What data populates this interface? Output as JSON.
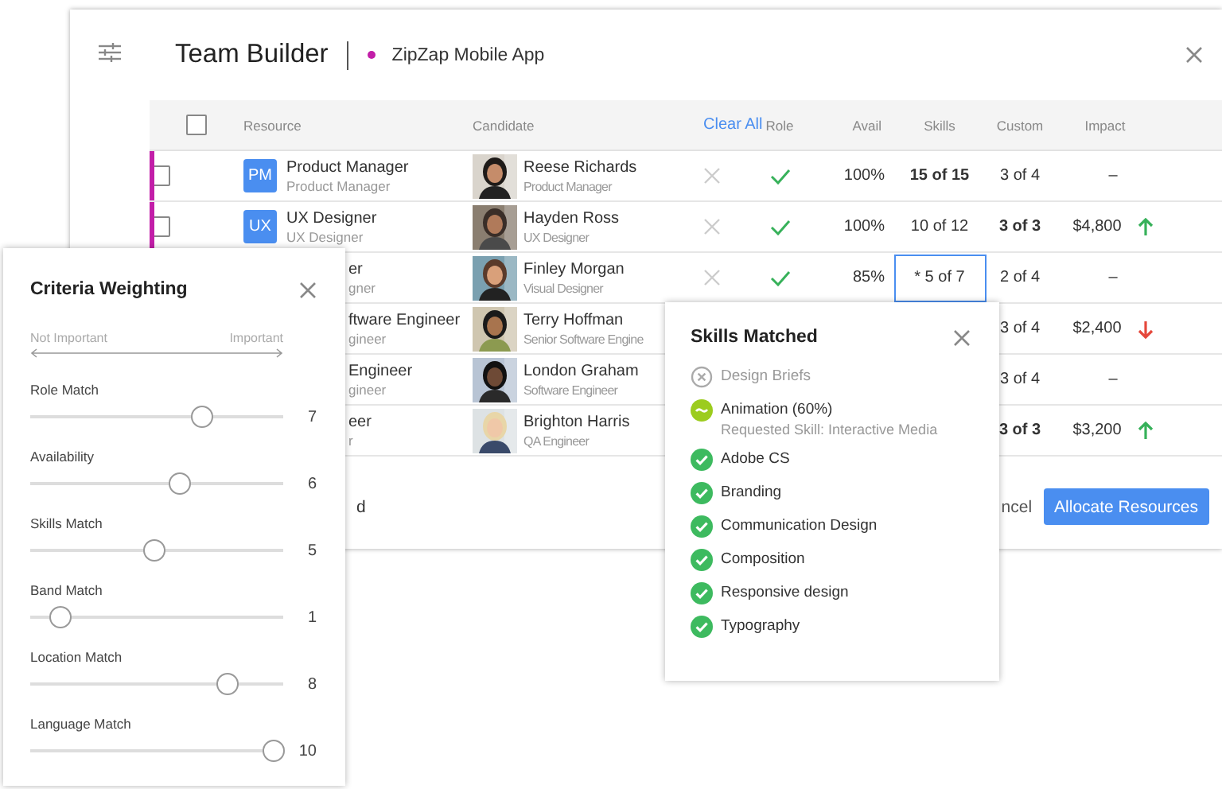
{
  "window": {
    "title": "Team Builder",
    "project": "ZipZap Mobile App"
  },
  "table": {
    "select_all": {
      "checked": false
    },
    "columns": [
      {
        "label": "Resource",
        "kind": "text"
      },
      {
        "label": "Candidate",
        "kind": "text"
      },
      {
        "label": "Clear All",
        "kind": "link"
      },
      {
        "label": "Role",
        "kind": "text"
      },
      {
        "label": "Avail",
        "kind": "text"
      },
      {
        "label": "Skills",
        "kind": "text"
      },
      {
        "label": "Custom",
        "kind": "text"
      },
      {
        "label": "Impact",
        "kind": "text"
      }
    ],
    "rows": [
      {
        "flagged": true,
        "checked": false,
        "badge": "PM",
        "resource": "Product Manager",
        "resource_sub": "Product Manager",
        "candidate": "Reese Richards",
        "candidate_role": "Product Manager",
        "removable": true,
        "role_match": true,
        "avail": "100%",
        "skills": {
          "text": "15 of 15",
          "complete": true,
          "selected": false
        },
        "custom": {
          "text": "3 of 4",
          "complete": false
        },
        "impact": {
          "text": "–"
        }
      },
      {
        "flagged": true,
        "checked": false,
        "badge": "UX",
        "resource": "UX Designer",
        "resource_sub": "UX Designer",
        "candidate": "Hayden Ross",
        "candidate_role": "UX Designer",
        "removable": true,
        "role_match": true,
        "avail": "100%",
        "skills": {
          "text": "10 of 12",
          "complete": false,
          "selected": false
        },
        "custom": {
          "text": "3 of 3",
          "complete": true
        },
        "impact": {
          "text": "$4,800",
          "rising": true
        }
      },
      {
        "resource": "er",
        "resource_sub": "gner",
        "candidate": "Finley Morgan",
        "candidate_role": "Visual Designer",
        "removable": true,
        "role_match": true,
        "avail": "85%",
        "skills": {
          "text": "* 5 of 7",
          "complete": false,
          "selected": true
        },
        "custom": {
          "text": "2 of 4",
          "complete": false
        },
        "impact": {
          "text": "–"
        }
      },
      {
        "resource": "ftware Engineer",
        "resource_sub": "gineer",
        "candidate": "Terry Hoffman",
        "candidate_role": "Senior Software Engine",
        "custom": {
          "text": "3 of 4",
          "complete": false
        },
        "impact": {
          "text": "$2,400",
          "rising": false
        }
      },
      {
        "resource": "Engineer",
        "resource_sub": "gineer",
        "candidate": "London Graham",
        "candidate_role": "Software Engineer",
        "custom": {
          "text": "3 of 4",
          "complete": false
        },
        "impact": {
          "text": "–"
        }
      },
      {
        "resource": "eer",
        "resource_sub": "r",
        "candidate": "Brighton Harris",
        "candidate_role": "QA Engineer",
        "custom": {
          "text": "3 of 3",
          "complete": true
        },
        "impact": {
          "text": "$3,200",
          "rising": true
        }
      }
    ]
  },
  "footer": {
    "left_fragment": "d",
    "cancel": "ncel",
    "primary": "Allocate Resources"
  },
  "criteria": {
    "title": "Criteria Weighting",
    "scale_low": "Not Important",
    "scale_high": "Important",
    "sliders": [
      {
        "label": "Role Match",
        "level": 0.68,
        "reading": "7"
      },
      {
        "label": "Availability",
        "level": 0.59,
        "reading": "6"
      },
      {
        "label": "Skills Match",
        "level": 0.49,
        "reading": "5"
      },
      {
        "label": "Band Match",
        "level": 0.12,
        "reading": "1"
      },
      {
        "label": "Location Match",
        "level": 0.78,
        "reading": "8"
      },
      {
        "label": "Language Match",
        "level": 0.96,
        "reading": "10"
      }
    ]
  },
  "skills_popup": {
    "title": "Skills Matched",
    "items": [
      {
        "kind": "missing",
        "label": "Design Briefs"
      },
      {
        "kind": "partial",
        "label": "Animation (60%)",
        "note": "Requested Skill: Interactive Media"
      },
      {
        "kind": "matched",
        "label": "Adobe CS"
      },
      {
        "kind": "matched",
        "label": "Branding"
      },
      {
        "kind": "matched",
        "label": "Communication Design"
      },
      {
        "kind": "matched",
        "label": "Composition"
      },
      {
        "kind": "matched",
        "label": "Responsive design"
      },
      {
        "kind": "matched",
        "label": "Typography"
      }
    ]
  }
}
